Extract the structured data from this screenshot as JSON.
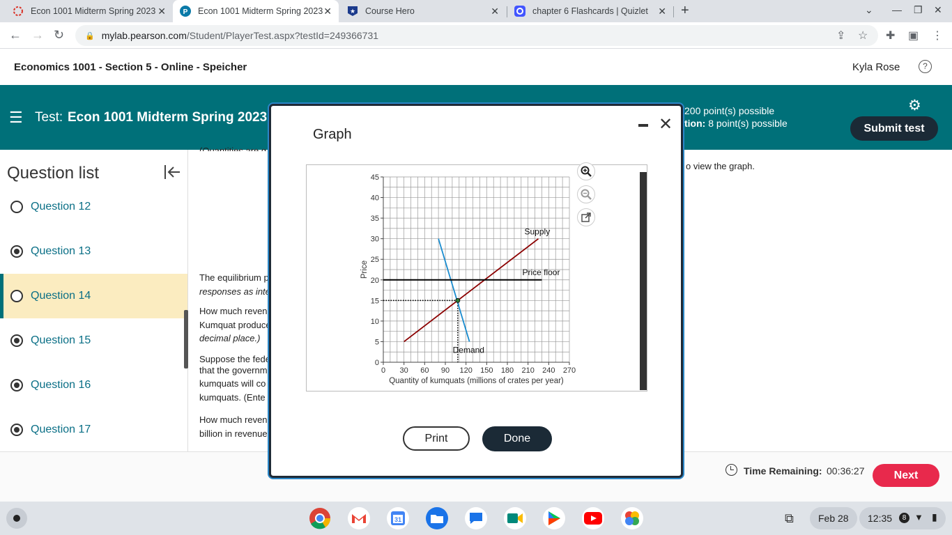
{
  "browser": {
    "tabs": [
      {
        "title": "Econ 1001 Midterm Spring 2023",
        "icon": "pearson-icon",
        "active": false
      },
      {
        "title": "Econ 1001 Midterm Spring 2023",
        "icon": "pearson-p-icon",
        "active": true
      },
      {
        "title": "Course Hero",
        "icon": "course-hero-icon",
        "active": false
      },
      {
        "title": "chapter 6 Flashcards | Quizlet",
        "icon": "quizlet-icon",
        "active": false
      }
    ],
    "url_host": "mylab.pearson.com",
    "url_path": "/Student/PlayerTest.aspx?testId=249366731"
  },
  "course": {
    "title": "Economics 1001 - Section 5 - Online - Speicher",
    "user": "Kyla Rose"
  },
  "test": {
    "label": "Test:",
    "name": "Econ 1001 Midterm Spring 2023",
    "points_total": "200 point(s) possible",
    "points_question_label": "tion:",
    "points_question": "8 point(s) possible",
    "submit_label": "Submit test"
  },
  "question_list": {
    "title": "Question list",
    "items": [
      {
        "label": "Question 12",
        "answered": false,
        "current": false
      },
      {
        "label": "Question 13",
        "answered": true,
        "current": false
      },
      {
        "label": "Question 14",
        "answered": false,
        "current": true
      },
      {
        "label": "Question 15",
        "answered": true,
        "current": false
      },
      {
        "label": "Question 16",
        "answered": true,
        "current": false
      },
      {
        "label": "Question 17",
        "answered": true,
        "current": false
      }
    ]
  },
  "content": {
    "clipped_top": "(Quantities are g",
    "view_graph": "o view the graph.",
    "lines": [
      "The equilibrium p",
      "responses as inte",
      "How much reven",
      "Kumquat produce",
      "decimal place.)",
      "Suppose the fede",
      "that the governm",
      "kumquats will co",
      "kumquats. (Ente",
      "How much reven",
      "billion in revenue"
    ]
  },
  "footer": {
    "time_label": "Time Remaining:",
    "time_value": "00:36:27",
    "next_label": "Next"
  },
  "modal": {
    "title": "Graph",
    "print_label": "Print",
    "done_label": "Done"
  },
  "chart_data": {
    "type": "line",
    "xlabel": "Quantity of kumquats (millions of crates per year)",
    "ylabel": "Price",
    "xlim": [
      0,
      270
    ],
    "ylim": [
      0,
      45
    ],
    "xticks": [
      0,
      30,
      60,
      90,
      120,
      150,
      180,
      210,
      240,
      270
    ],
    "yticks": [
      0,
      5,
      10,
      15,
      20,
      25,
      30,
      35,
      40,
      45
    ],
    "grid": true,
    "series": [
      {
        "name": "Supply",
        "color": "#8b0000",
        "points": [
          [
            30,
            5
          ],
          [
            225,
            30
          ]
        ]
      },
      {
        "name": "Demand",
        "color": "#1a8ccf",
        "points": [
          [
            80,
            30
          ],
          [
            125,
            5
          ]
        ]
      },
      {
        "name": "Price floor",
        "color": "#000000",
        "points": [
          [
            0,
            20
          ],
          [
            230,
            20
          ]
        ]
      }
    ],
    "equilibrium": {
      "x": 108,
      "y": 15
    }
  },
  "taskbar": {
    "date": "Feb 28",
    "time": "12:35",
    "notifications": "8"
  }
}
